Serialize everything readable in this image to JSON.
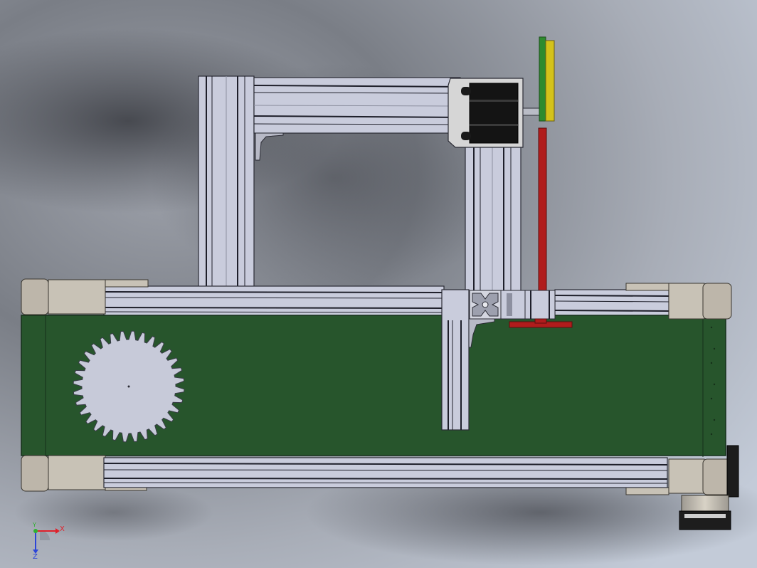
{
  "triad": {
    "x_label": "X",
    "y_label": "Y",
    "z_label": "Z",
    "x_color": "#e0202a",
    "y_color": "#2fb12f",
    "z_color": "#2c45d8"
  },
  "colors": {
    "belt_green": "#27552c",
    "extrusion_fill": "#c9ccdc",
    "extrusion_groove": "#1e1f2a",
    "motor_body": "#141414",
    "motor_bracket": "#d6d6d6",
    "pulley_cap": "#bdb6aa",
    "gear_fill": "#c7cad9",
    "red_rod": "#b01c1c",
    "green_part": "#2e8b2e",
    "yellow_part": "#d4c21a"
  }
}
